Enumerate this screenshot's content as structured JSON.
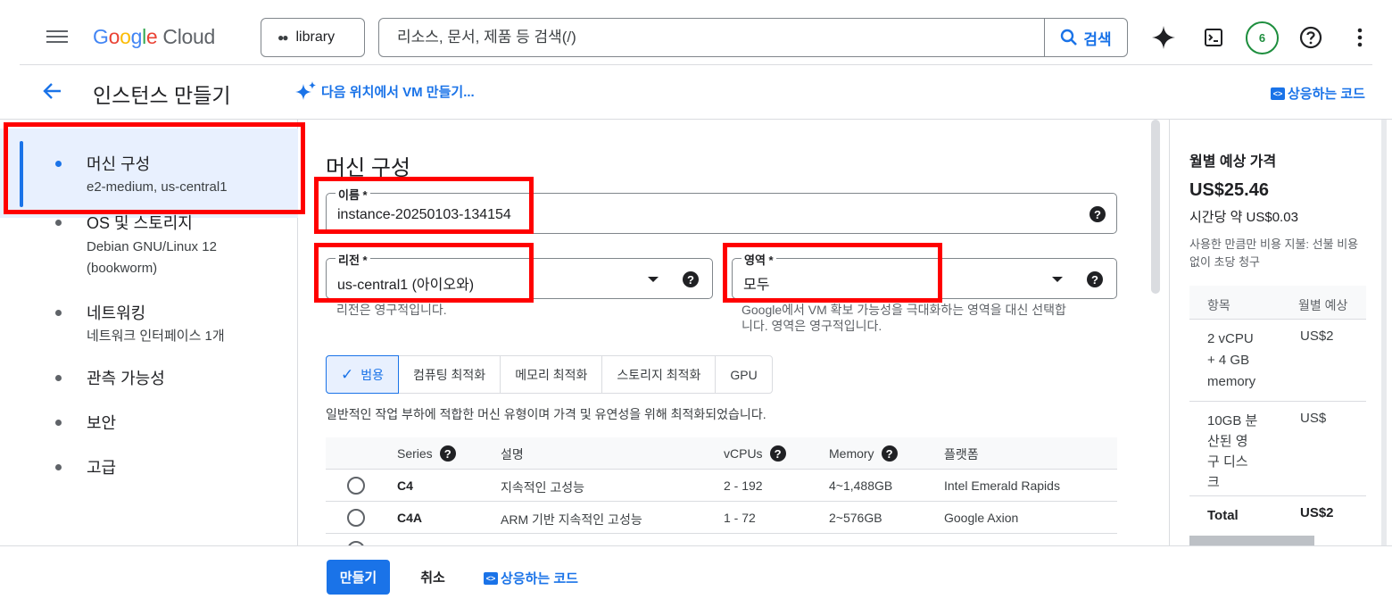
{
  "header": {
    "logo_google": "Google",
    "logo_cloud": "Cloud",
    "project_name": "library",
    "search_placeholder": "리소스, 문서, 제품 등 검색(/)",
    "search_button": "검색",
    "notification_count": "6"
  },
  "page": {
    "title": "인스턴스 만들기",
    "vm_link": "다음 위치에서 VM 만들기...",
    "code_link": "상응하는 코드"
  },
  "sidebar": {
    "items": [
      {
        "label": "머신 구성",
        "sub": "e2-medium, us-central1",
        "active": true
      },
      {
        "label": "OS 및 스토리지",
        "sub1": "Debian GNU/Linux 12",
        "sub2": "(bookworm)"
      },
      {
        "label": "네트워킹",
        "sub": "네트워크 인터페이스 1개"
      },
      {
        "label": "관측 가능성"
      },
      {
        "label": "보안"
      },
      {
        "label": "고급"
      }
    ]
  },
  "form": {
    "section_title": "머신 구성",
    "name_label": "이름 *",
    "name_value": "instance-20250103-134154",
    "region_label": "리전 *",
    "region_value": "us-central1 (아이오와)",
    "region_hint": "리전은 영구적입니다.",
    "zone_label": "영역 *",
    "zone_value": "모두",
    "zone_hint_1": "Google에서 VM 확보 가능성을 극대화하는 영역을 대신 선택합",
    "zone_hint_2": "니다. 영역은 영구적입니다.",
    "tabs": [
      "범용",
      "컴퓨팅 최적화",
      "메모리 최적화",
      "스토리지 최적화",
      "GPU"
    ],
    "tab_description": "일반적인 작업 부하에 적합한 머신 유형이며 가격 및 유연성을 위해 최적화되었습니다."
  },
  "series_table": {
    "headers": {
      "series": "Series",
      "desc": "설명",
      "vcpus": "vCPUs",
      "memory": "Memory",
      "platform": "플랫폼"
    },
    "rows": [
      {
        "series": "C4",
        "desc": "지속적인 고성능",
        "vcpus": "2 - 192",
        "memory": "4~1,488GB",
        "platform": "Intel Emerald Rapids"
      },
      {
        "series": "C4A",
        "desc": "ARM 기반 지속적인 고성능",
        "vcpus": "1 - 72",
        "memory": "2~576GB",
        "platform": "Google Axion"
      }
    ]
  },
  "pricing": {
    "title": "월별 예상 가격",
    "price": "US$25.46",
    "hourly": "시간당 약 US$0.03",
    "note": "사용한 만큼만 비용 지불: 선불 비용 없이 초당 청구",
    "col_item": "항목",
    "col_monthly": "월별 예상",
    "rows": [
      {
        "item_1": "2 vCPU",
        "item_2": "+ 4 GB",
        "item_3": "memory",
        "cost": "US$2"
      },
      {
        "item_1": "10GB 분",
        "item_2": "산된 영",
        "item_3": "구 디스",
        "item_4": "크",
        "cost": "US$"
      }
    ],
    "total_label": "Total",
    "total_value": "US$2"
  },
  "footer": {
    "create": "만들기",
    "cancel": "취소",
    "code_link": "상응하는 코드"
  },
  "colors": {
    "accent": "#1a73e8",
    "highlight": "#ff0000",
    "active_bg": "#e8f0fe"
  }
}
